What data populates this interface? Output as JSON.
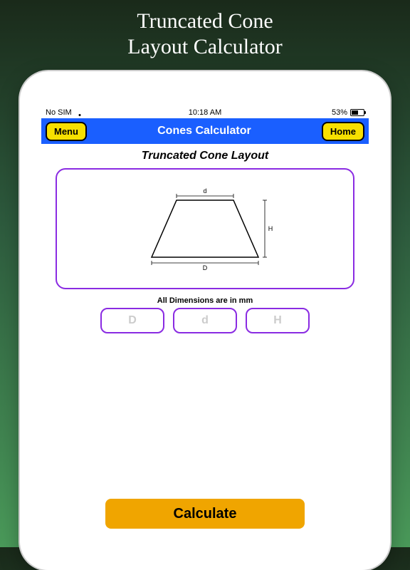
{
  "promo": {
    "line1": "Truncated Cone",
    "line2": "Layout Calculator"
  },
  "status": {
    "carrier": "No SIM",
    "time": "10:18 AM",
    "battery": "53%"
  },
  "header": {
    "menu": "Menu",
    "title": "Cones Calculator",
    "home": "Home"
  },
  "main": {
    "title": "Truncated Cone Layout",
    "diagram": {
      "label_d": "d",
      "label_D": "D",
      "label_H": "H"
    },
    "note": "All Dimensions are in mm",
    "inputs": {
      "D": "D",
      "d": "d",
      "H": "H"
    },
    "calculate": "Calculate"
  }
}
